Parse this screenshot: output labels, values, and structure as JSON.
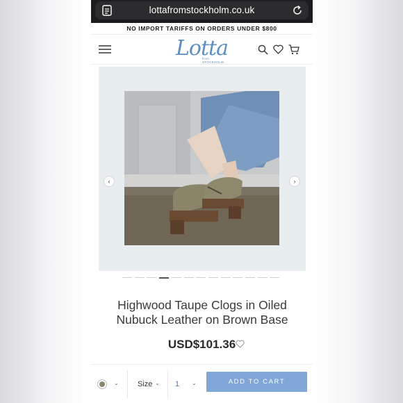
{
  "browser": {
    "url": "lottafromstockholm.co.uk",
    "tabs_icon": "tabs-icon",
    "reload_icon": "reload-icon"
  },
  "announcement": "NO IMPORT TARIFFS ON ORDERS UNDER $800",
  "header": {
    "logo_text": "Lotta",
    "logo_subtext": "from STOCKHOLM",
    "menu_icon": "hamburger-menu-icon",
    "icons": [
      "search-icon",
      "heart-icon",
      "cart-icon"
    ]
  },
  "gallery": {
    "prev_glyph": "‹",
    "next_glyph": "›",
    "slide_count": 13,
    "active_slide": 4
  },
  "product": {
    "title_line1": "Highwood Taupe Clogs in Oiled",
    "title_line2": "Nubuck Leather on Brown Base",
    "price": "USD$101.36"
  },
  "purchase_bar": {
    "color_swatch": "#8a8868",
    "size_label": "Size",
    "quantity": "1",
    "add_to_cart_label": "ADD TO CART"
  },
  "colors": {
    "accent": "#7fa6d6",
    "logo": "#5d8fc1"
  }
}
